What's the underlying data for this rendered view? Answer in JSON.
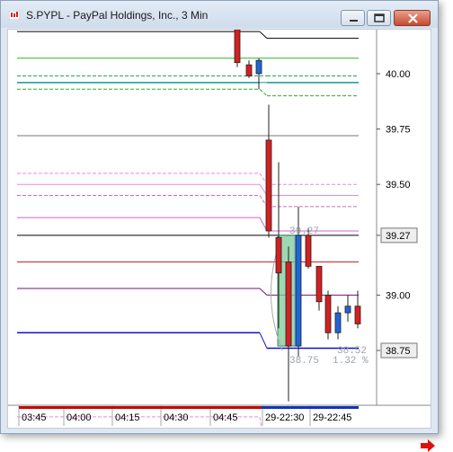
{
  "window": {
    "title": "S.PYPL - PayPal Holdings, Inc., 3 Min"
  },
  "icons": {
    "app": "chart-app-icon",
    "minimize": "minimize-icon",
    "maximize": "maximize-icon",
    "close": "close-icon",
    "scroll_right": "red-arrow-right-icon"
  },
  "colors": {
    "up_candle": "#1f66d6",
    "down_candle": "#d42020",
    "close_button": "#c74a33",
    "scroll_arrow": "#e01010"
  },
  "price_axis": {
    "ticks": [
      "40.00",
      "39.75",
      "39.50",
      "39.27",
      "39.00",
      "38.75"
    ],
    "current_high_tag": "39.27",
    "current_low_tag": "38.75"
  },
  "time_axis": {
    "ticks": [
      "03:45",
      "04:00",
      "04:15",
      "04:30",
      "04:45",
      "29-22:30",
      "29-22:45"
    ]
  },
  "annotations": {
    "range_high": "39.27",
    "range_low": "38.52",
    "range_low_secondary": "38.75",
    "range_percent": "1.32 %"
  },
  "chart_data": {
    "type": "candlestick",
    "ylim": [
      38.25,
      40.25
    ],
    "levels": [
      {
        "price": 40.19,
        "color": "#000000",
        "style": "solid"
      },
      {
        "price": 40.07,
        "color": "#22bb22",
        "style": "solid"
      },
      {
        "price": 39.99,
        "color": "#22aa55",
        "style": "dashed"
      },
      {
        "price": 39.96,
        "color": "#119999",
        "style": "solid"
      },
      {
        "price": 39.93,
        "color": "#33aa33",
        "style": "dashed"
      },
      {
        "price": 39.72,
        "color": "#777777",
        "style": "solid"
      },
      {
        "price": 39.55,
        "color": "#ee88dd",
        "style": "dashed"
      },
      {
        "price": 39.5,
        "color": "#ee88dd",
        "style": "solid"
      },
      {
        "price": 39.45,
        "color": "#cc66cc",
        "style": "dashed"
      },
      {
        "price": 39.35,
        "color": "#cc66cc",
        "style": "solid"
      },
      {
        "price": 39.27,
        "color": "#000000",
        "style": "solid"
      },
      {
        "price": 39.15,
        "color": "#cc2222",
        "style": "solid"
      },
      {
        "price": 39.03,
        "color": "#771177",
        "style": "solid"
      },
      {
        "price": 38.83,
        "color": "#1111cc",
        "style": "solid"
      },
      {
        "price": 38.45,
        "color": "#ee88dd",
        "style": "dashed"
      }
    ],
    "candles": [
      {
        "t": "04:52",
        "open": 40.2,
        "high": 40.22,
        "low": 40.03,
        "close": 40.05
      },
      {
        "t": "04:55",
        "open": 40.04,
        "high": 40.06,
        "low": 39.98,
        "close": 39.99
      },
      {
        "t": "04:58",
        "open": 40.0,
        "high": 40.07,
        "low": 39.93,
        "close": 40.06
      },
      {
        "t": "22:24",
        "open": 39.7,
        "high": 39.86,
        "low": 39.26,
        "close": 39.29
      },
      {
        "t": "22:27",
        "open": 39.26,
        "high": 39.6,
        "low": 38.85,
        "close": 39.1
      },
      {
        "t": "22:30",
        "open": 39.15,
        "high": 39.22,
        "low": 38.52,
        "close": 38.77
      },
      {
        "t": "22:33",
        "open": 38.77,
        "high": 39.4,
        "low": 38.72,
        "close": 39.27
      },
      {
        "t": "22:36",
        "open": 39.27,
        "high": 39.3,
        "low": 39.12,
        "close": 39.13
      },
      {
        "t": "22:39",
        "open": 39.13,
        "high": 39.13,
        "low": 38.93,
        "close": 38.97
      },
      {
        "t": "22:42",
        "open": 39.0,
        "high": 39.02,
        "low": 38.8,
        "close": 38.83
      },
      {
        "t": "22:45",
        "open": 38.83,
        "high": 38.95,
        "low": 38.8,
        "close": 38.92
      },
      {
        "t": "22:48",
        "open": 38.92,
        "high": 39.0,
        "low": 38.88,
        "close": 38.95
      },
      {
        "t": "22:51",
        "open": 38.95,
        "high": 39.02,
        "low": 38.85,
        "close": 38.87
      }
    ]
  }
}
